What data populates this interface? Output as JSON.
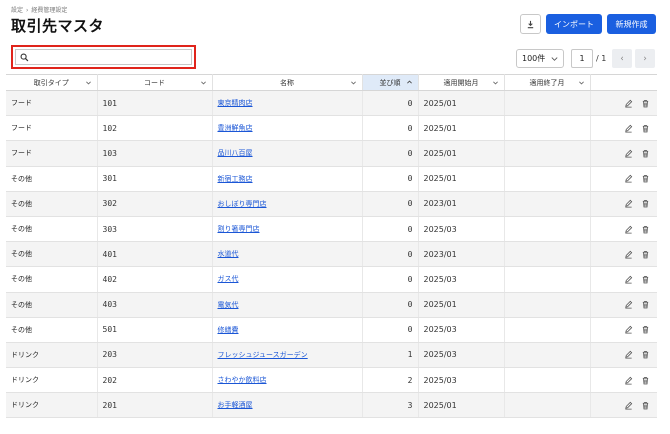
{
  "breadcrumb": [
    "設定",
    "経費管理設定"
  ],
  "page_title": "取引先マスタ",
  "toolbar": {
    "import_label": "インポート",
    "new_label": "新規作成"
  },
  "search": {
    "placeholder": "",
    "value": ""
  },
  "pagination": {
    "page_size": "100件",
    "current_page": "1",
    "total_pages": "/ 1",
    "prev_glyph": "‹",
    "next_glyph": "›"
  },
  "columns": [
    "取引タイプ",
    "コード",
    "名称",
    "並び順",
    "適用開始月",
    "適用終了月"
  ],
  "sort_glyph": "︿",
  "rows": [
    {
      "type": "フード",
      "code": "101",
      "name": "東京精肉店",
      "order": "0",
      "start": "2025/01",
      "end": ""
    },
    {
      "type": "フード",
      "code": "102",
      "name": "豊洲鮮魚店",
      "order": "0",
      "start": "2025/01",
      "end": ""
    },
    {
      "type": "フード",
      "code": "103",
      "name": "品川八百屋",
      "order": "0",
      "start": "2025/01",
      "end": ""
    },
    {
      "type": "その他",
      "code": "301",
      "name": "新宿工務店",
      "order": "0",
      "start": "2025/01",
      "end": ""
    },
    {
      "type": "その他",
      "code": "302",
      "name": "おしぼり専門店",
      "order": "0",
      "start": "2023/01",
      "end": ""
    },
    {
      "type": "その他",
      "code": "303",
      "name": "割り箸専門店",
      "order": "0",
      "start": "2025/03",
      "end": ""
    },
    {
      "type": "その他",
      "code": "401",
      "name": "水道代",
      "order": "0",
      "start": "2023/01",
      "end": ""
    },
    {
      "type": "その他",
      "code": "402",
      "name": "ガス代",
      "order": "0",
      "start": "2025/03",
      "end": ""
    },
    {
      "type": "その他",
      "code": "403",
      "name": "電気代",
      "order": "0",
      "start": "2025/01",
      "end": ""
    },
    {
      "type": "その他",
      "code": "501",
      "name": "修繕費",
      "order": "0",
      "start": "2025/03",
      "end": ""
    },
    {
      "type": "ドリンク",
      "code": "203",
      "name": "フレッシュジュースガーデン",
      "order": "1",
      "start": "2025/03",
      "end": ""
    },
    {
      "type": "ドリンク",
      "code": "202",
      "name": "さわやか飲料店",
      "order": "2",
      "start": "2025/03",
      "end": ""
    },
    {
      "type": "ドリンク",
      "code": "201",
      "name": "お手軽酒屋",
      "order": "3",
      "start": "2025/01",
      "end": ""
    }
  ],
  "colors": {
    "primary": "#1a5fe0",
    "highlight_border": "#e0241b",
    "sorted_header": "#dfeaf8",
    "link": "#1a56d6"
  }
}
